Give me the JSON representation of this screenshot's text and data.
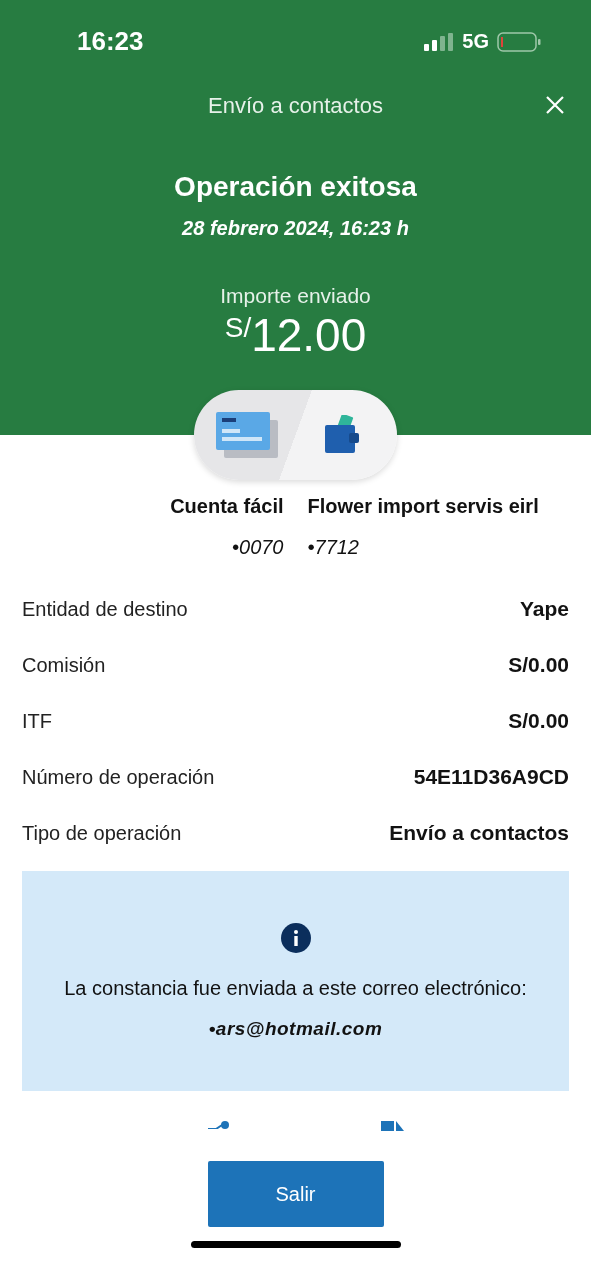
{
  "status_bar": {
    "time": "16:23",
    "network": "5G"
  },
  "header": {
    "title": "Envío a contactos",
    "status": "Operación exitosa",
    "datetime": "28 febrero 2024, 16:23 h",
    "amount_label": "Importe enviado",
    "currency": "S/",
    "amount": "12.00"
  },
  "accounts": [
    {
      "name": "Cuenta fácil",
      "number": "•0070"
    },
    {
      "name": "Flower import servis eirl",
      "number": "•7712"
    }
  ],
  "details": [
    {
      "label": "Entidad de destino",
      "value": "Yape"
    },
    {
      "label": "Comisión",
      "value": "S/0.00"
    },
    {
      "label": "ITF",
      "value": "S/0.00"
    },
    {
      "label": "Número de operación",
      "value": "54E11D36A9CD"
    },
    {
      "label": "Tipo de operación",
      "value": "Envío a contactos"
    }
  ],
  "notice": {
    "text": "La constancia fue enviada a este correo electrónico:",
    "email": "•ars@hotmail.com"
  },
  "buttons": [
    "Salir"
  ]
}
